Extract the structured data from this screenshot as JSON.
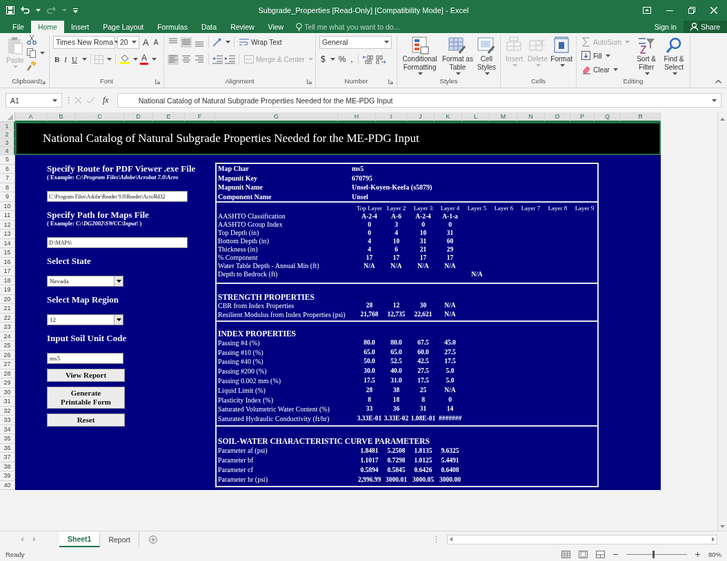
{
  "window": {
    "title": "Subgrade_Properties [Read-Only] [Compatibility Mode] - Excel"
  },
  "ribbon_tabs": [
    {
      "label": "File",
      "selected": false
    },
    {
      "label": "Home",
      "selected": true
    },
    {
      "label": "Insert",
      "selected": false
    },
    {
      "label": "Page Layout",
      "selected": false
    },
    {
      "label": "Formulas",
      "selected": false
    },
    {
      "label": "Data",
      "selected": false
    },
    {
      "label": "Review",
      "selected": false
    },
    {
      "label": "View",
      "selected": false
    }
  ],
  "tell_me": {
    "placeholder": "Tell me what you want to do..."
  },
  "account": {
    "sign_in": "Sign in",
    "share": "Share"
  },
  "ribbon": {
    "clipboard": {
      "label": "Clipboard",
      "paste": {
        "label": "Paste",
        "disabled": true
      }
    },
    "font": {
      "label": "Font",
      "name": "Times New Roma",
      "size": "20",
      "grow": "A",
      "shrink": "A",
      "styles": [
        "B",
        "I",
        "U"
      ],
      "color_letter": "A"
    },
    "alignment": {
      "label": "Alignment",
      "wrap": {
        "label": "Wrap Text",
        "disabled": false
      },
      "merge": {
        "label": "Merge & Center",
        "disabled": true
      }
    },
    "number": {
      "label": "Number",
      "format": "General",
      "symbols": [
        "$",
        "%",
        ","
      ]
    },
    "styles": {
      "label": "Styles",
      "buttons": [
        {
          "label": "Conditional Formatting"
        },
        {
          "label": "Format as Table"
        },
        {
          "label": "Cell Styles"
        }
      ]
    },
    "cells": {
      "label": "Cells",
      "buttons": [
        {
          "label": "Insert",
          "disabled": true
        },
        {
          "label": "Delete",
          "disabled": true
        },
        {
          "label": "Format",
          "disabled": false
        }
      ]
    },
    "editing": {
      "label": "Editing",
      "small": [
        {
          "label": "AutoSum",
          "disabled": true
        },
        {
          "label": "Fill",
          "disabled": false
        },
        {
          "label": "Clear",
          "disabled": false
        }
      ],
      "big": [
        {
          "label": "Sort & Filter"
        },
        {
          "label": "Find & Select"
        }
      ]
    }
  },
  "formula_bar": {
    "name_box": "A1",
    "function_label": "fx",
    "formula": "National Catalog of Natural Subgrade Properties Needed for the ME-PDG Input"
  },
  "sheet": {
    "columns": [
      {
        "label": "A",
        "selected": true
      },
      {
        "label": "B",
        "selected": true
      },
      {
        "label": "C",
        "selected": true
      },
      {
        "label": "D",
        "selected": true
      },
      {
        "label": "E",
        "selected": true
      },
      {
        "label": "F",
        "selected": true
      },
      {
        "label": "G",
        "selected": true
      },
      {
        "label": "H",
        "selected": true
      },
      {
        "label": "I",
        "selected": true
      },
      {
        "label": "J",
        "selected": true
      },
      {
        "label": "K",
        "selected": true
      },
      {
        "label": "L",
        "selected": true
      },
      {
        "label": "M",
        "selected": true
      },
      {
        "label": "N",
        "selected": true
      },
      {
        "label": "O",
        "selected": true
      },
      {
        "label": "P",
        "selected": true
      },
      {
        "label": "Q",
        "selected": true
      },
      {
        "label": "R",
        "selected": true
      }
    ],
    "rows": [
      {
        "label": "1",
        "selected": true
      },
      {
        "label": "2",
        "selected": true
      },
      {
        "label": "3",
        "selected": true
      },
      {
        "label": "4",
        "selected": true
      },
      {
        "label": "5",
        "selected": false
      },
      {
        "label": "6",
        "selected": false
      },
      {
        "label": "7",
        "selected": false
      },
      {
        "label": "8",
        "selected": false
      },
      {
        "label": "9",
        "selected": false
      },
      {
        "label": "10",
        "selected": false
      },
      {
        "label": "11",
        "selected": false
      },
      {
        "label": "12",
        "selected": false
      },
      {
        "label": "13",
        "selected": false
      },
      {
        "label": "14",
        "selected": false
      },
      {
        "label": "15",
        "selected": false
      },
      {
        "label": "16",
        "selected": false
      },
      {
        "label": "17",
        "selected": false
      },
      {
        "label": "18",
        "selected": false
      },
      {
        "label": "19",
        "selected": false
      },
      {
        "label": "20",
        "selected": false
      },
      {
        "label": "21",
        "selected": false
      },
      {
        "label": "22",
        "selected": false
      },
      {
        "label": "23",
        "selected": false
      },
      {
        "label": "24",
        "selected": false
      },
      {
        "label": "25",
        "selected": false
      },
      {
        "label": "26",
        "selected": false
      },
      {
        "label": "27",
        "selected": false
      },
      {
        "label": "28",
        "selected": false
      },
      {
        "label": "29",
        "selected": false
      },
      {
        "label": "30",
        "selected": false
      },
      {
        "label": "31",
        "selected": false
      },
      {
        "label": "32",
        "selected": false
      },
      {
        "label": "33",
        "selected": false
      },
      {
        "label": "34",
        "selected": false
      },
      {
        "label": "35",
        "selected": false
      },
      {
        "label": "36",
        "selected": false
      },
      {
        "label": "37",
        "selected": false
      },
      {
        "label": "38",
        "selected": false
      },
      {
        "label": "39",
        "selected": false
      },
      {
        "label": "40",
        "selected": false
      }
    ]
  },
  "banner": {
    "title": "National Catalog of Natural Subgrade Properties Needed for the ME-PDG Input"
  },
  "form": [
    {
      "kind": "heading",
      "text": "Specify Route for PDF Viewer .exe File"
    },
    {
      "kind": "example",
      "text": "( Example:  *C:\\Program Files\\Adobe\\Acrobat 7.0\\Acro*"
    },
    {
      "kind": "path_field",
      "value": "C:\\Program Files\\Adobe\\Reader 9.0\\Reader\\AcroRd32"
    },
    {
      "kind": "heading",
      "text": "Specify Path for Maps File"
    },
    {
      "kind": "example",
      "text": "( Example:  *C:\\DG2002\\SWCC\\Input\\* )"
    },
    {
      "kind": "path_field",
      "value": "D:\\MAPS\\"
    },
    {
      "kind": "heading",
      "text": "Select State"
    },
    {
      "kind": "dropdown",
      "value": "Nevada"
    },
    {
      "kind": "heading",
      "text": "Select Map Region"
    },
    {
      "kind": "dropdown",
      "value": "12"
    },
    {
      "kind": "heading",
      "text": "Input Soil Unit Code"
    },
    {
      "kind": "code_field",
      "value": "ms5"
    },
    {
      "kind": "button",
      "text": "View Report"
    },
    {
      "kind": "button",
      "text": "Generate Printable Form"
    },
    {
      "kind": "button",
      "text": "Reset"
    }
  ],
  "soil_table": {
    "info": [
      {
        "label": "Map Char",
        "value": "ms5"
      },
      {
        "label": "Mapunit Key",
        "value": "670795"
      },
      {
        "label": "Mapunit Name",
        "value": "Unsel-Koyen-Keefa (s5879)"
      },
      {
        "label": "Component Name",
        "value": "Unsel"
      }
    ],
    "layer_columns": [
      "Top Layer",
      "Layer 2",
      "Layer 3",
      "Layer 4",
      "Layer 5",
      "Layer 6",
      "Layer 7",
      "Layer 8",
      "Layer 9"
    ],
    "layer_rows": [
      {
        "label": "AASHTO Classification",
        "values": [
          "A-2-4",
          "A-6",
          "A-2-4",
          "A-1-a"
        ]
      },
      {
        "label": "AASHTO Group Index",
        "values": [
          "0",
          "3",
          "0",
          "0"
        ]
      },
      {
        "label": "Top Depth (in)",
        "values": [
          "0",
          "4",
          "10",
          "31"
        ]
      },
      {
        "label": "Bottom Depth (in)",
        "values": [
          "4",
          "10",
          "31",
          "60"
        ]
      },
      {
        "label": "Thickness (in)",
        "values": [
          "4",
          "6",
          "21",
          "29"
        ]
      },
      {
        "label": "% Component",
        "values": [
          "17",
          "17",
          "17",
          "17"
        ]
      },
      {
        "label": "Water Table Depth - Annual Min (ft)",
        "values": [
          "N/A",
          "N/A",
          "N/A",
          "N/A"
        ]
      },
      {
        "label": "Depth to Bedrock (ft)",
        "kind": "layer_5_only",
        "value": "N/A"
      }
    ],
    "sections": [
      {
        "title": "STRENGTH PROPERTIES",
        "rows": [
          {
            "label": "CBR from Index Properties",
            "values": [
              "28",
              "12",
              "30",
              "N/A"
            ]
          },
          {
            "label": "Resilient Modulus from Index Properties (psi)",
            "values": [
              "21,768",
              "12,735",
              "22,621",
              "N/A"
            ]
          }
        ]
      },
      {
        "title": "INDEX PROPERTIES",
        "rows": [
          {
            "label": "Passing #4 (%)",
            "values": [
              "80.0",
              "80.0",
              "67.5",
              "45.0"
            ]
          },
          {
            "label": "Passing #10 (%)",
            "values": [
              "65.0",
              "65.0",
              "60.0",
              "27.5"
            ]
          },
          {
            "label": "Passing #40 (%)",
            "values": [
              "50.0",
              "52.5",
              "42.5",
              "17.5"
            ]
          },
          {
            "label": "Passing #200 (%)",
            "values": [
              "30.0",
              "40.0",
              "27.5",
              "5.0"
            ]
          },
          {
            "label": "Passing 0.002 mm (%)",
            "values": [
              "17.5",
              "31.0",
              "17.5",
              "5.0"
            ]
          },
          {
            "label": "Liquid Limit (%)",
            "values": [
              "28",
              "38",
              "25",
              "N/A"
            ]
          },
          {
            "label": "Plasticity Index (%)",
            "values": [
              "8",
              "18",
              "8",
              "0"
            ]
          },
          {
            "label": "Saturated Volumetric Water Content (%)",
            "values": [
              "33",
              "36",
              "31",
              "14"
            ]
          },
          {
            "label": "Saturated Hydraulic Conductivity (ft/hr)",
            "values": [
              "3.33E-01",
              "3.33E-02",
              "1.08E-01",
              "#######"
            ]
          }
        ]
      },
      {
        "title": "SOIL-WATER CHARACTERISTIC CURVE PARAMETERS",
        "rows": [
          {
            "label": "Parameter af (psi)",
            "values": [
              "1.8481",
              "5.2508",
              "1.8135",
              "9.6325"
            ]
          },
          {
            "label": "Parameter bf",
            "values": [
              "1.1017",
              "0.7298",
              "1.0125",
              "5.4491"
            ]
          },
          {
            "label": "Parameter cf",
            "values": [
              "0.5894",
              "0.5845",
              "0.6426",
              "0.6408"
            ]
          },
          {
            "label": "Parameter hr (psi)",
            "values": [
              "2,996.99",
              "3000.01",
              "3000.05",
              "3000.00"
            ]
          }
        ]
      }
    ]
  },
  "sheet_tabs": [
    {
      "label": "Sheet1",
      "selected": true
    },
    {
      "label": "Report",
      "selected": false
    }
  ],
  "status_bar": {
    "status": "Ready",
    "zoom": "80%",
    "zoom_slider": {
      "level": 0.44
    }
  }
}
